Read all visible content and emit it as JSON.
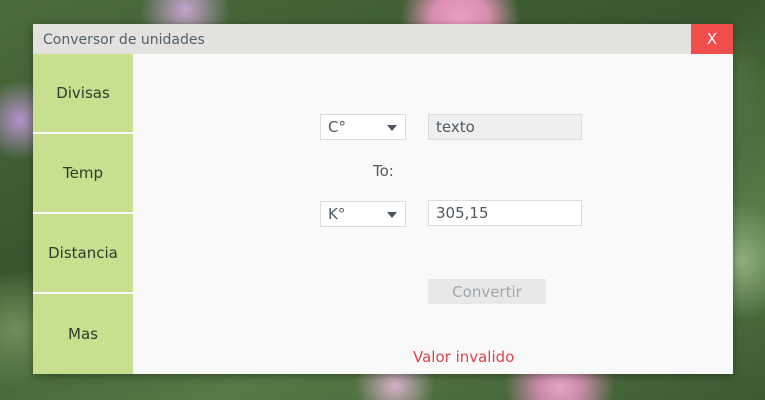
{
  "window": {
    "title": "Conversor de unidades",
    "close_label": "X"
  },
  "sidebar": {
    "items": [
      {
        "label": "Divisas"
      },
      {
        "label": "Temp"
      },
      {
        "label": "Distancia"
      },
      {
        "label": "Mas"
      }
    ]
  },
  "converter": {
    "from_unit": "C°",
    "input_value": "texto",
    "to_label": "To:",
    "to_unit": "K°",
    "output_value": "305,15",
    "convert_label": "Convertir",
    "error_text": "Valor invalido"
  },
  "colors": {
    "sidebar_bg": "#c7e08f",
    "close_bg": "#f24d4d",
    "error": "#e0454b"
  }
}
